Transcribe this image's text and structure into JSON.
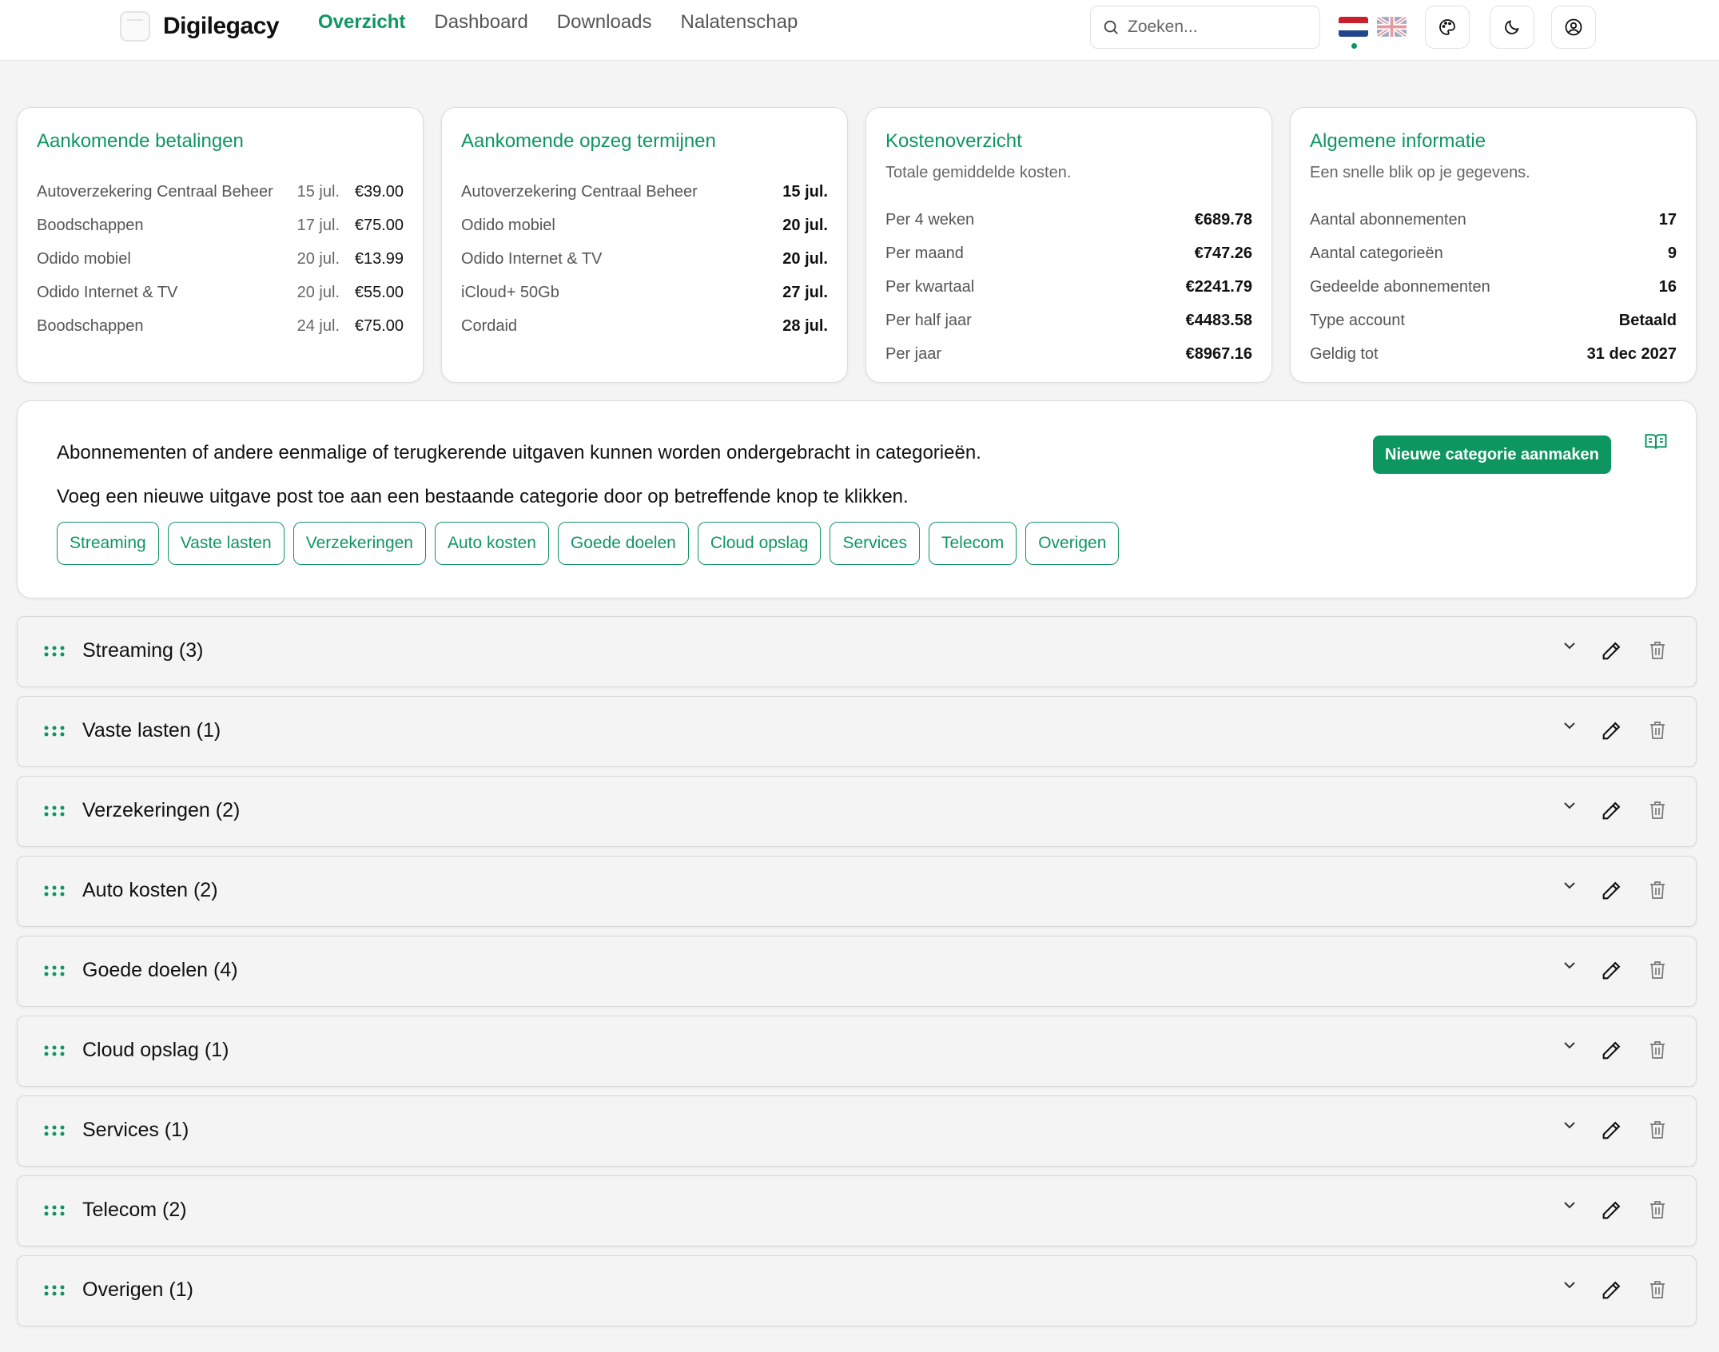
{
  "header": {
    "brand": "Digilegacy",
    "nav": [
      "Overzicht",
      "Dashboard",
      "Downloads",
      "Nalatenschap"
    ],
    "active_nav": "Overzicht",
    "search_placeholder": "Zoeken...",
    "languages": [
      "nl",
      "en"
    ],
    "active_language": "nl",
    "icons": [
      "palette-icon",
      "moon-icon",
      "user-circle-icon"
    ]
  },
  "cards": {
    "payments": {
      "title": "Aankomende betalingen",
      "rows": [
        {
          "label": "Autoverzekering Centraal Beheer",
          "date": "15 jul.",
          "amount": "€39.00"
        },
        {
          "label": "Boodschappen",
          "date": "17 jul.",
          "amount": "€75.00"
        },
        {
          "label": "Odido mobiel",
          "date": "20 jul.",
          "amount": "€13.99"
        },
        {
          "label": "Odido Internet & TV",
          "date": "20 jul.",
          "amount": "€55.00"
        },
        {
          "label": "Boodschappen",
          "date": "24 jul.",
          "amount": "€75.00"
        }
      ]
    },
    "cancellations": {
      "title": "Aankomende opzeg termijnen",
      "rows": [
        {
          "label": "Autoverzekering Centraal Beheer",
          "value": "15 jul."
        },
        {
          "label": "Odido mobiel",
          "value": "20 jul."
        },
        {
          "label": "Odido Internet & TV",
          "value": "20 jul."
        },
        {
          "label": "iCloud+ 50Gb",
          "value": "27 jul."
        },
        {
          "label": "Cordaid",
          "value": "28 jul."
        }
      ]
    },
    "costs": {
      "title": "Kostenoverzicht",
      "subtitle": "Totale gemiddelde kosten.",
      "rows": [
        {
          "label": "Per 4 weken",
          "value": "€689.78"
        },
        {
          "label": "Per maand",
          "value": "€747.26"
        },
        {
          "label": "Per kwartaal",
          "value": "€2241.79"
        },
        {
          "label": "Per half jaar",
          "value": "€4483.58"
        },
        {
          "label": "Per jaar",
          "value": "€8967.16"
        }
      ]
    },
    "general": {
      "title": "Algemene informatie",
      "subtitle": "Een snelle blik op je gegevens.",
      "rows": [
        {
          "label": "Aantal abonnementen",
          "value": "17"
        },
        {
          "label": "Aantal categorieën",
          "value": "9"
        },
        {
          "label": "Gedeelde abonnementen",
          "value": "16"
        },
        {
          "label": "Type account",
          "value": "Betaald"
        },
        {
          "label": "Geldig tot",
          "value": "31 dec 2027"
        }
      ]
    }
  },
  "category_panel": {
    "text1": "Abonnementen of andere eenmalige of terugkerende uitgaven kunnen worden ondergebracht in categorieën.",
    "text2": "Voeg een nieuwe uitgave post toe aan een bestaande categorie door op betreffende knop te klikken.",
    "new_button": "Nieuwe categorie aanmaken",
    "chips": [
      "Streaming",
      "Vaste lasten",
      "Verzekeringen",
      "Auto kosten",
      "Goede doelen",
      "Cloud opslag",
      "Services",
      "Telecom",
      "Overigen"
    ]
  },
  "categories": [
    {
      "label": "Streaming (3)"
    },
    {
      "label": "Vaste lasten (1)"
    },
    {
      "label": "Verzekeringen (2)"
    },
    {
      "label": "Auto kosten (2)"
    },
    {
      "label": "Goede doelen (4)"
    },
    {
      "label": "Cloud opslag (1)"
    },
    {
      "label": "Services (1)"
    },
    {
      "label": "Telecom (2)"
    },
    {
      "label": "Overigen (1)"
    }
  ],
  "colors": {
    "accent": "#0e9660",
    "background": "#f4f4f4"
  }
}
